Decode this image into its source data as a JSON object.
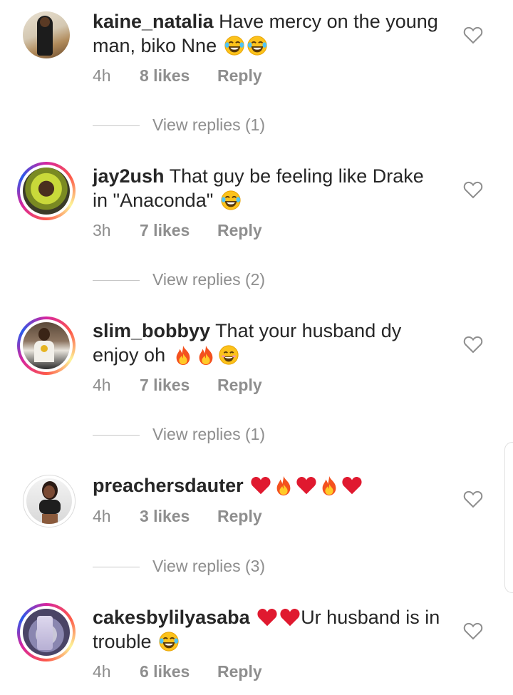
{
  "comments": [
    {
      "username": "kaine_natalia",
      "text": "Have mercy on the young man, biko Nne",
      "time": "4h",
      "likes": "8 likes",
      "reply": "Reply",
      "view_replies": "View replies (1)"
    },
    {
      "username": "jay2ush",
      "text": "That guy be feeling like Drake in \"Anaconda\"",
      "time": "3h",
      "likes": "7 likes",
      "reply": "Reply",
      "view_replies": "View replies (2)"
    },
    {
      "username": "slim_bobbyy",
      "text": "That your husband dy enjoy oh",
      "time": "4h",
      "likes": "7 likes",
      "reply": "Reply",
      "view_replies": "View replies (1)"
    },
    {
      "username": "preachersdauter",
      "text": "",
      "time": "4h",
      "likes": "3 likes",
      "reply": "Reply",
      "view_replies": "View replies (3)"
    },
    {
      "username": "cakesbylilyasaba",
      "text": "Ur husband is in trouble",
      "time": "4h",
      "likes": "6 likes",
      "reply": "Reply"
    }
  ],
  "icons": {
    "like": "heart-outline-icon",
    "emoji_laugh": "tears-of-joy-emoji",
    "emoji_smile": "smile-emoji",
    "emoji_fire": "fire-emoji",
    "emoji_heart": "red-heart-emoji"
  },
  "colors": {
    "text": "#262626",
    "secondary": "#8e8e8e",
    "story_ring": "#d6249f"
  }
}
